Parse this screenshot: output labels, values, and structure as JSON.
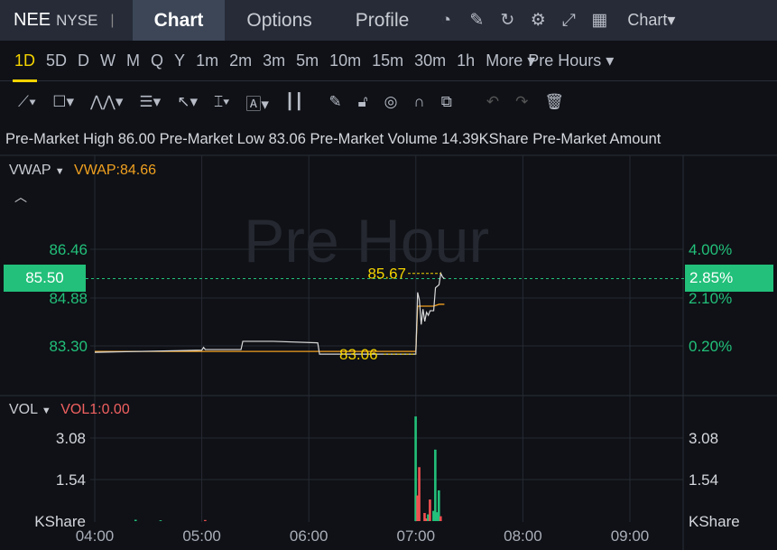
{
  "header": {
    "symbol": "NEE",
    "exchange": "NYSE",
    "tabs": [
      "Chart",
      "Options",
      "Profile"
    ],
    "active_tab": "Chart",
    "chart_menu": "Chart▾",
    "icons": [
      "gauge-icon",
      "edit-icon",
      "refresh-icon",
      "gear-icon",
      "fullscreen-icon",
      "grid-icon"
    ]
  },
  "periods": {
    "items": [
      "1D",
      "5D",
      "D",
      "W",
      "M",
      "Q",
      "Y",
      "1m",
      "2m",
      "3m",
      "5m",
      "10m",
      "15m",
      "30m",
      "1h",
      "More ▾"
    ],
    "active": "1D",
    "session": "Pre Hours ▾"
  },
  "tools": [
    "line-tool",
    "rectangle-tool",
    "pattern-tool",
    "fib-tool",
    "arrow-tool",
    "measure-tool",
    "text-tool",
    "indicator-tool",
    "pencil",
    "lock",
    "eye",
    "magnet",
    "layers",
    "undo",
    "redo",
    "delete"
  ],
  "info": "Pre-Market High 86.00 Pre-Market Low 83.06 Pre-Market Volume 14.39KShare Pre-Market Amount",
  "main": {
    "indicator": "VWAP",
    "indicator_value": "VWAP:84.66",
    "watermark": "Pre Hour",
    "current_price": "85.50",
    "current_pct": "2.85%",
    "high_label": "85.67",
    "low_label": "83.06",
    "left_ticks": [
      "86.46",
      "84.88",
      "83.30"
    ],
    "right_ticks": [
      "4.00%",
      "2.10%",
      "0.20%"
    ],
    "colors": {
      "up": "#22c07a",
      "price": "#d9d9d9",
      "vwap": "#f0a020",
      "label": "#f5d300"
    }
  },
  "vol": {
    "indicator": "VOL",
    "indicator_value": "VOL1:0.00",
    "ticks": [
      "3.08",
      "1.54",
      "KShare"
    ],
    "right_ticks": [
      "3.08",
      "1.54",
      "KShare"
    ]
  },
  "xaxis": [
    "04:00",
    "05:00",
    "06:00",
    "07:00",
    "08:00",
    "09:00"
  ],
  "chart_data": {
    "type": "line",
    "ylim": [
      82.6,
      87.4
    ],
    "price": [
      [
        0,
        83.09
      ],
      [
        60,
        83.16
      ],
      [
        61,
        83.25
      ],
      [
        62,
        83.18
      ],
      [
        82,
        83.18
      ],
      [
        83,
        83.45
      ],
      [
        100,
        83.45
      ],
      [
        125,
        83.4
      ],
      [
        126,
        83.03
      ],
      [
        180,
        83.03
      ],
      [
        181,
        85.05
      ],
      [
        182,
        84.8
      ],
      [
        183,
        84.0
      ],
      [
        184,
        84.5
      ],
      [
        185,
        84.1
      ],
      [
        186,
        84.4
      ],
      [
        187,
        84.3
      ],
      [
        188,
        84.45
      ],
      [
        190,
        84.45
      ],
      [
        191,
        85.2
      ],
      [
        193,
        85.3
      ],
      [
        194,
        85.67
      ],
      [
        195,
        85.55
      ],
      [
        196,
        85.5
      ]
    ],
    "vwap": [
      [
        0,
        83.12
      ],
      [
        180,
        83.12
      ],
      [
        181,
        84.6
      ],
      [
        186,
        84.6
      ],
      [
        190,
        84.6
      ],
      [
        193,
        84.66
      ],
      [
        196,
        84.66
      ]
    ],
    "volume": [
      [
        23,
        0.05,
        "up"
      ],
      [
        37,
        0.03,
        "up"
      ],
      [
        62,
        0.04,
        "down"
      ],
      [
        180,
        3.88,
        "up"
      ],
      [
        181,
        0.95,
        "down"
      ],
      [
        182,
        2.0,
        "down"
      ],
      [
        185,
        0.3,
        "down"
      ],
      [
        186,
        0.1,
        "down"
      ],
      [
        187,
        0.25,
        "up"
      ],
      [
        188,
        0.8,
        "down"
      ],
      [
        190,
        0.38,
        "up"
      ],
      [
        191,
        2.65,
        "up"
      ],
      [
        192,
        0.33,
        "up"
      ],
      [
        193,
        1.14,
        "up"
      ],
      [
        194,
        0.18,
        "down"
      ]
    ]
  }
}
